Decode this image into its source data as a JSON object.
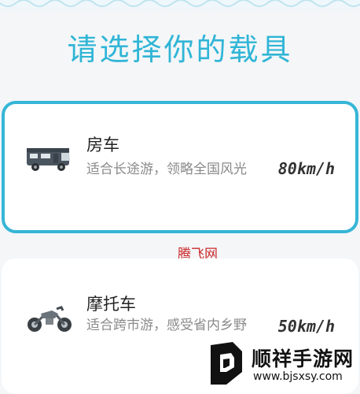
{
  "page": {
    "title": "请选择你的载具",
    "accent_color": "#2fb5d6"
  },
  "vehicles": [
    {
      "name": "房车",
      "description": "适合长途游，领略全国风光",
      "speed": "80km/h",
      "icon": "rv-icon",
      "selected": true
    },
    {
      "name": "摩托车",
      "description": "适合跨市游，感受省内乡野",
      "speed": "50km/h",
      "icon": "motorcycle-icon",
      "selected": false
    }
  ],
  "watermarks": {
    "center_text": "腾飞网",
    "logo_name": "顺祥手游网",
    "logo_url": "www.bjsxsy.com"
  }
}
